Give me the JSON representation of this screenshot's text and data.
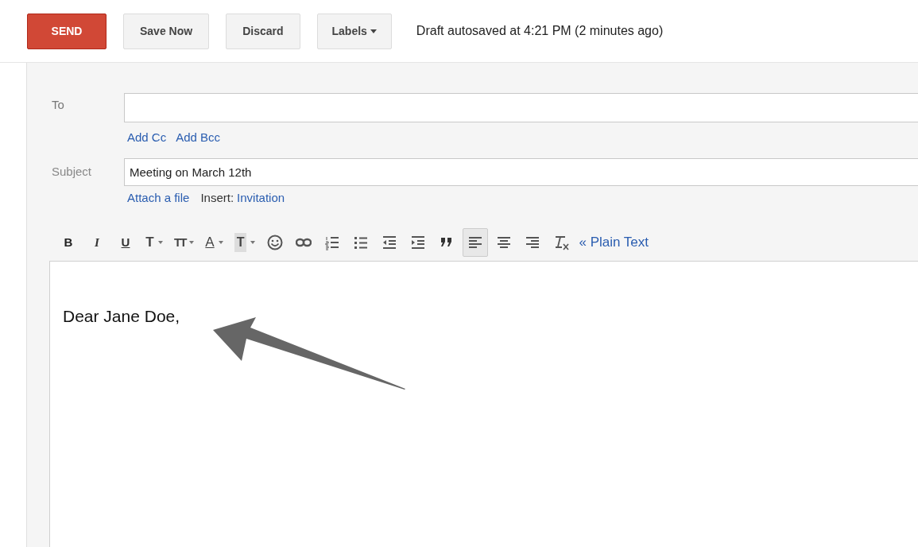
{
  "toolbar": {
    "buttons": [
      {
        "kind": "primary",
        "label": "SEND"
      },
      {
        "kind": "plain",
        "label": "Save Now"
      },
      {
        "kind": "plain",
        "label": "Discard"
      },
      {
        "kind": "menu",
        "label": "Labels"
      }
    ],
    "status": "Draft autosaved at 4:21 PM (2 minutes ago)"
  },
  "compose": {
    "to": {
      "label": "To"
    },
    "cc_links": [
      "Add Cc",
      "Add Bcc"
    ],
    "subject": {
      "label": "Subject",
      "value": "Meeting on March 12th"
    },
    "attach_link": "Attach a file",
    "insert_label": "Insert:",
    "insert_link": "Invitation",
    "format_bar": [
      {
        "kind": "bold",
        "text": "B"
      },
      {
        "kind": "italic",
        "text": "I"
      },
      {
        "kind": "underline",
        "text": "U"
      },
      {
        "kind": "font",
        "text": "T",
        "dropdown": true
      },
      {
        "kind": "size",
        "text": "TT",
        "dropdown": true
      },
      {
        "kind": "text-color",
        "text": "A",
        "dropdown": true
      },
      {
        "kind": "highlight",
        "text": "T",
        "dropdown": true
      },
      {
        "kind": "emoji"
      },
      {
        "kind": "link"
      },
      {
        "kind": "numbered-list"
      },
      {
        "kind": "bulleted-list"
      },
      {
        "kind": "indent-less"
      },
      {
        "kind": "indent-more"
      },
      {
        "kind": "quote"
      },
      {
        "kind": "align-left",
        "selected": true
      },
      {
        "kind": "align-center",
        "selected": false
      },
      {
        "kind": "align-right",
        "selected": false
      },
      {
        "kind": "clear-format"
      }
    ],
    "plain_text_link": "« Plain Text",
    "body": "Dear Jane Doe,"
  }
}
